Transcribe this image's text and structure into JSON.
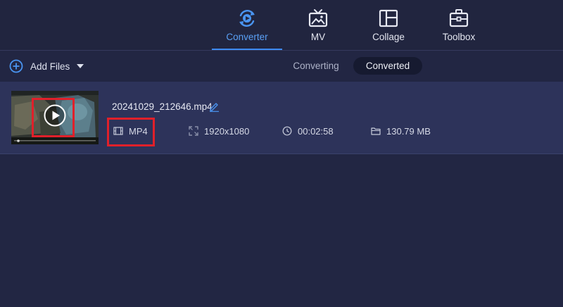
{
  "nav": {
    "items": [
      {
        "id": "converter",
        "label": "Converter",
        "icon": "converter-icon",
        "active": true
      },
      {
        "id": "mv",
        "label": "MV",
        "icon": "tv-icon",
        "active": false
      },
      {
        "id": "collage",
        "label": "Collage",
        "icon": "collage-icon",
        "active": false
      },
      {
        "id": "toolbox",
        "label": "Toolbox",
        "icon": "toolbox-icon",
        "active": false
      }
    ]
  },
  "toolbar": {
    "add_files_label": "Add Files",
    "tabs": [
      {
        "label": "Converting",
        "active": false
      },
      {
        "label": "Converted",
        "active": true
      }
    ]
  },
  "file": {
    "name": "20241029_212646.mp4",
    "format": "MP4",
    "resolution": "1920x1080",
    "duration": "00:02:58",
    "size": "130.79 MB"
  },
  "colors": {
    "accent": "#3d8af0",
    "background": "#222643",
    "row_background": "#2d335a",
    "highlight": "#e0202a"
  }
}
